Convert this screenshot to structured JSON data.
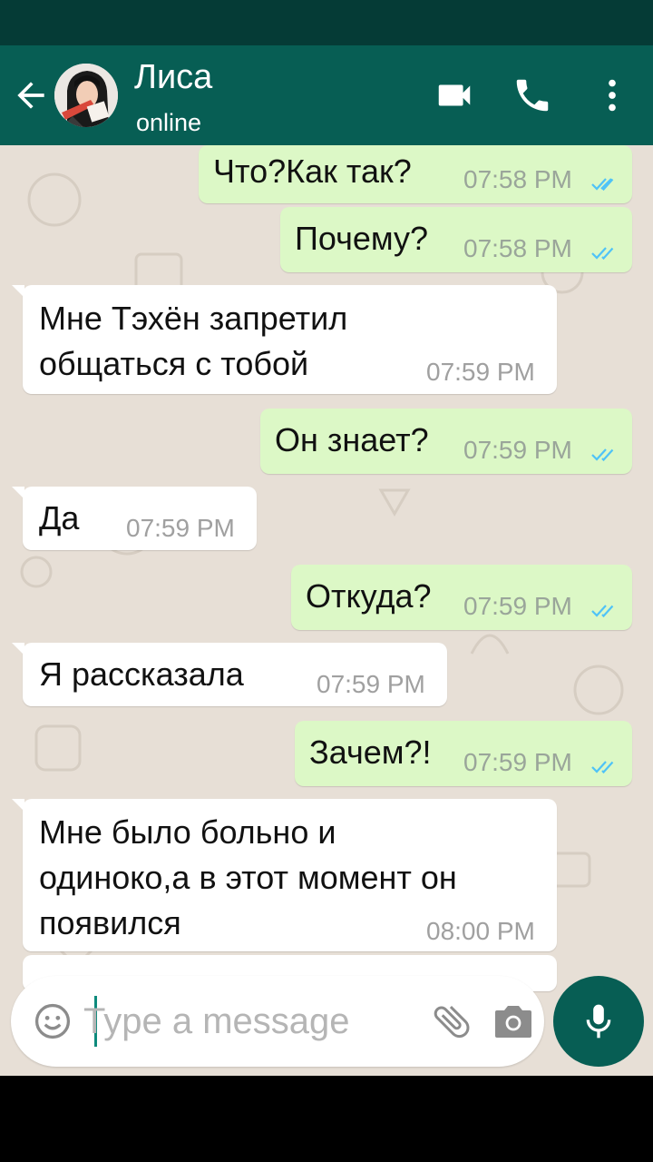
{
  "header": {
    "contact_name": "Лиса",
    "contact_status": "online",
    "icons": [
      "back-arrow-icon",
      "video-call-icon",
      "phone-icon",
      "more-vert-icon"
    ]
  },
  "messages": [
    {
      "direction": "outgoing",
      "text": "Что?Как так?",
      "time": "07:58 PM",
      "status": "read"
    },
    {
      "direction": "outgoing",
      "text": "Почему?",
      "time": "07:58 PM",
      "status": "read"
    },
    {
      "direction": "incoming",
      "text": "Мне Тэхён запретил\nобщаться с тобой",
      "time": "07:59 PM"
    },
    {
      "direction": "outgoing",
      "text": "Он знает?",
      "time": "07:59 PM",
      "status": "read"
    },
    {
      "direction": "incoming",
      "text": "Да",
      "time": "07:59 PM"
    },
    {
      "direction": "outgoing",
      "text": "Откуда?",
      "time": "07:59 PM",
      "status": "read"
    },
    {
      "direction": "incoming",
      "text": "Я рассказала",
      "time": "07:59 PM"
    },
    {
      "direction": "outgoing",
      "text": "Зачем?!",
      "time": "07:59 PM",
      "status": "read"
    },
    {
      "direction": "incoming",
      "text": "Мне было больно и\nодиноко,а в этот момент он\nпоявился",
      "time": "08:00 PM"
    }
  ],
  "composer": {
    "placeholder": "Type a message",
    "value": "",
    "icons": [
      "emoji-icon",
      "attach-icon",
      "camera-icon",
      "mic-icon"
    ]
  },
  "colors": {
    "header": "#075e54",
    "status_bar": "#053b36",
    "outgoing_bubble": "#dcf8c6",
    "incoming_bubble": "#ffffff",
    "chat_background": "#e7dfd6",
    "read_ticks": "#4fc3f7"
  }
}
